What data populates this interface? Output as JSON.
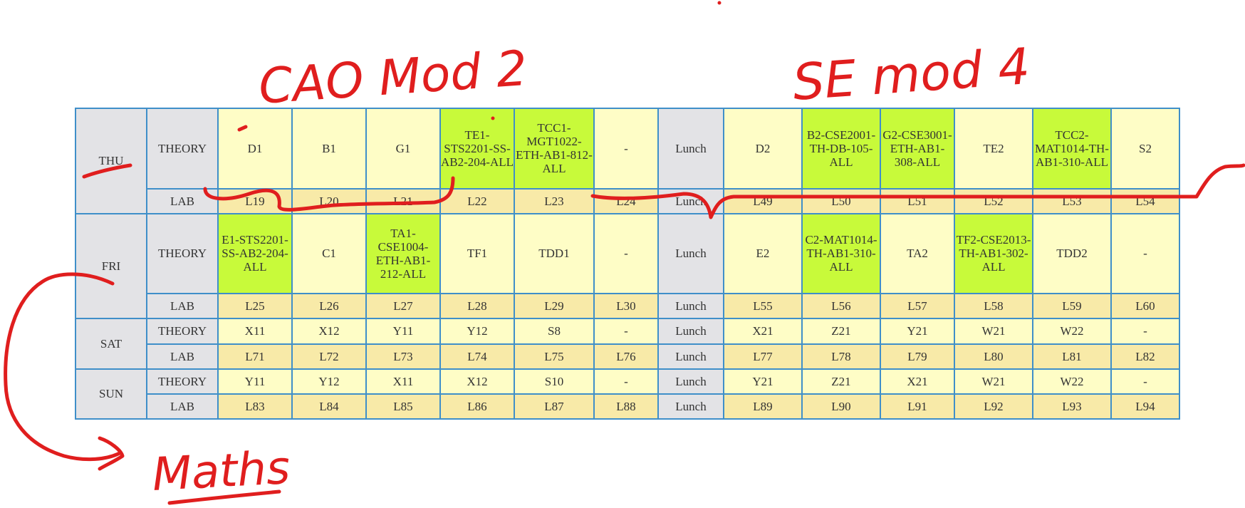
{
  "colors": {
    "border": "#3f8fc9",
    "day_bg": "#e3e3e6",
    "theory_bg": "#fefdc6",
    "lab_bg": "#f8eaa8",
    "highlight_bg": "#c8fa3a",
    "annotation_ink": "#e01e1e"
  },
  "annotations": {
    "left_note": "CAO Mod 2",
    "right_note": "SE mod 4",
    "bottom_note": "Maths"
  },
  "timetable": {
    "days": [
      {
        "day": "THU",
        "theory_label": "THEORY",
        "theory": [
          "D1",
          "B1",
          "G1",
          "TE1-STS2201-SS-AB2-204-ALL",
          "TCC1-MGT1022-ETH-AB1-812-ALL",
          "-",
          "Lunch",
          "D2",
          "B2-CSE2001-TH-DB-105-ALL",
          "G2-CSE3001-ETH-AB1-308-ALL",
          "TE2",
          "TCC2-MAT1014-TH-AB1-310-ALL",
          "S2"
        ],
        "lab_label": "LAB",
        "lab": [
          "L19",
          "L20",
          "L21",
          "L22",
          "L23",
          "L24",
          "Lunch",
          "L49",
          "L50",
          "L51",
          "L52",
          "L53",
          "L54"
        ]
      },
      {
        "day": "FRI",
        "theory_label": "THEORY",
        "theory": [
          "E1-STS2201-SS-AB2-204-ALL",
          "C1",
          "TA1-CSE1004-ETH-AB1-212-ALL",
          "TF1",
          "TDD1",
          "-",
          "Lunch",
          "E2",
          "C2-MAT1014-TH-AB1-310-ALL",
          "TA2",
          "TF2-CSE2013-TH-AB1-302-ALL",
          "TDD2",
          "-"
        ],
        "lab_label": "LAB",
        "lab": [
          "L25",
          "L26",
          "L27",
          "L28",
          "L29",
          "L30",
          "Lunch",
          "L55",
          "L56",
          "L57",
          "L58",
          "L59",
          "L60"
        ]
      },
      {
        "day": "SAT",
        "theory_label": "THEORY",
        "theory": [
          "X11",
          "X12",
          "Y11",
          "Y12",
          "S8",
          "-",
          "Lunch",
          "X21",
          "Z21",
          "Y21",
          "W21",
          "W22",
          "-"
        ],
        "lab_label": "LAB",
        "lab": [
          "L71",
          "L72",
          "L73",
          "L74",
          "L75",
          "L76",
          "Lunch",
          "L77",
          "L78",
          "L79",
          "L80",
          "L81",
          "L82"
        ]
      },
      {
        "day": "SUN",
        "theory_label": "THEORY",
        "theory": [
          "Y11",
          "Y12",
          "X11",
          "X12",
          "S10",
          "-",
          "Lunch",
          "Y21",
          "Z21",
          "X21",
          "W21",
          "W22",
          "-"
        ],
        "lab_label": "LAB",
        "lab": [
          "L83",
          "L84",
          "L85",
          "L86",
          "L87",
          "L88",
          "Lunch",
          "L89",
          "L90",
          "L91",
          "L92",
          "L93",
          "L94"
        ]
      }
    ]
  }
}
